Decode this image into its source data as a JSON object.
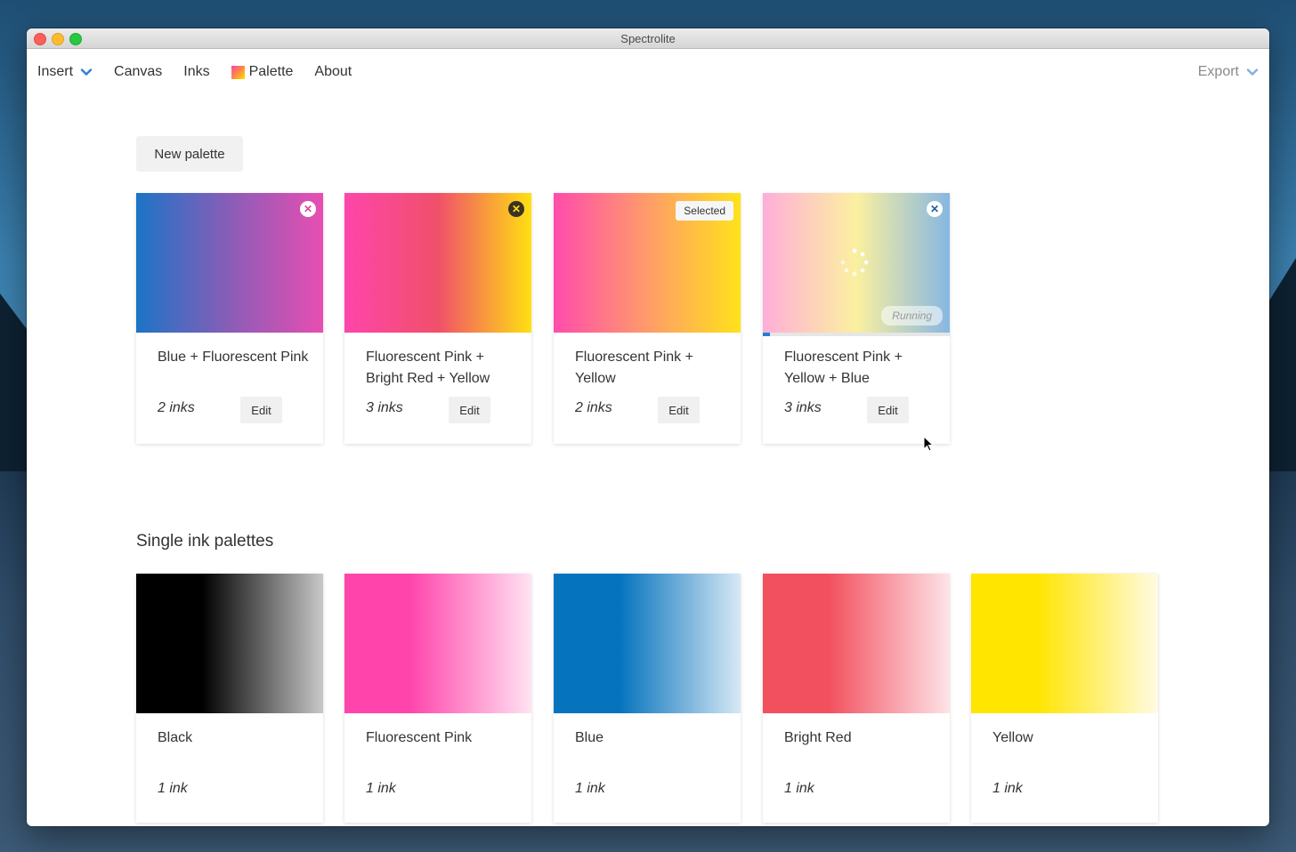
{
  "window": {
    "title": "Spectrolite"
  },
  "menu": {
    "insert": "Insert",
    "canvas": "Canvas",
    "inks": "Inks",
    "palette": "Palette",
    "about": "About",
    "export": "Export"
  },
  "actions": {
    "new_palette": "New palette"
  },
  "palettes": [
    {
      "name": "Blue + Fluorescent Pink",
      "count": "2 inks",
      "edit": "Edit",
      "state": "delete-light",
      "colors": [
        "#1c74c6",
        "#8a5db7",
        "#e84eb2"
      ]
    },
    {
      "name": "Fluorescent Pink + Bright Red + Yellow",
      "count": "3 inks",
      "edit": "Edit",
      "state": "delete-dark",
      "colors": [
        "#ff45ab",
        "#f0506a",
        "#ffe012"
      ]
    },
    {
      "name": "Fluorescent Pink + Yellow",
      "count": "2 inks",
      "edit": "Edit",
      "state": "selected",
      "badge": "Selected",
      "colors": [
        "#ff4cac",
        "#ff9b6a",
        "#ffe21a"
      ]
    },
    {
      "name": "Fluorescent Pink + Yellow + Blue",
      "count": "3 inks",
      "edit": "Edit",
      "state": "running",
      "badge": "Running",
      "progress": 0.04,
      "colors": [
        "#ffaed8",
        "#fbf0a0",
        "#86b7e2"
      ]
    }
  ],
  "single_section_title": "Single ink palettes",
  "single_inks": [
    {
      "name": "Black",
      "count": "1 ink",
      "colors": [
        "#000000",
        "#c8c8c8"
      ]
    },
    {
      "name": "Fluorescent Pink",
      "count": "1 ink",
      "colors": [
        "#ff45ab",
        "#ffe3f2"
      ]
    },
    {
      "name": "Blue",
      "count": "1 ink",
      "colors": [
        "#0573bd",
        "#d7e8f5"
      ]
    },
    {
      "name": "Bright Red",
      "count": "1 ink",
      "colors": [
        "#f2505e",
        "#fde4e8"
      ]
    },
    {
      "name": "Yellow",
      "count": "1 ink",
      "colors": [
        "#ffe500",
        "#fffbe3"
      ]
    }
  ]
}
